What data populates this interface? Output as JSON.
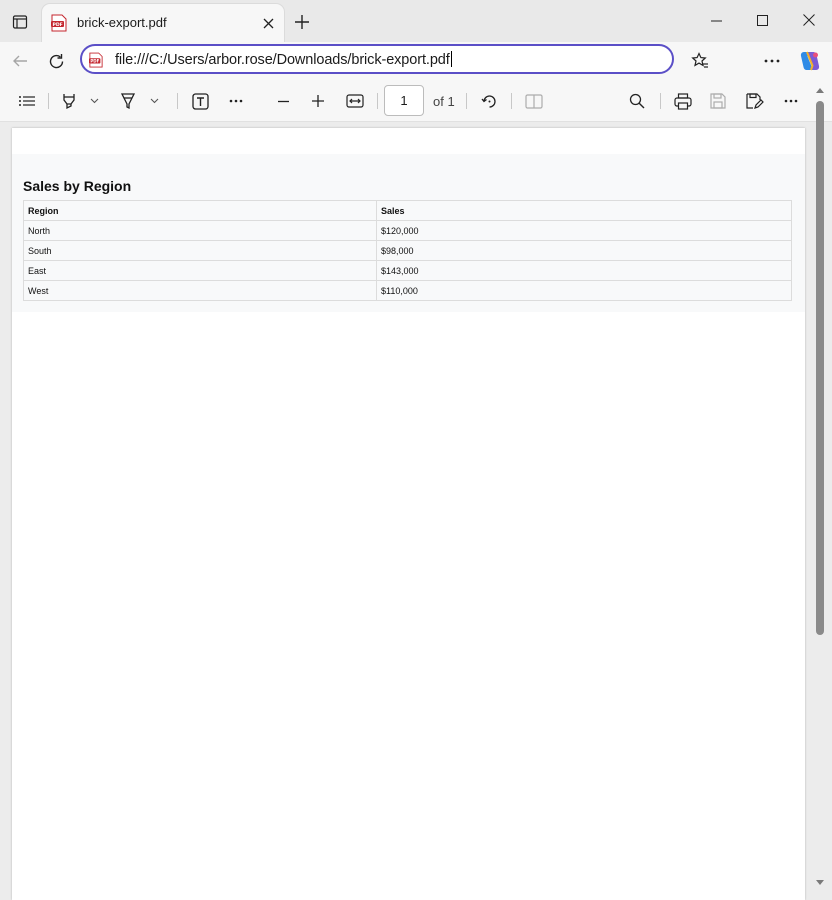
{
  "browser": {
    "tab": {
      "title": "brick-export.pdf"
    },
    "address_bar": {
      "url": "file:///C:/Users/arbor.rose/Downloads/brick-export.pdf"
    }
  },
  "pdf_toolbar": {
    "page_number": "1",
    "page_count_label": "of 1"
  },
  "document": {
    "title": "Sales by Region",
    "table": {
      "headers": [
        "Region",
        "Sales"
      ],
      "rows": [
        [
          "North",
          "$120,000"
        ],
        [
          "South",
          "$98,000"
        ],
        [
          "East",
          "$143,000"
        ],
        [
          "West",
          "$110,000"
        ]
      ]
    }
  },
  "colors": {
    "accent": "#5b4fc7",
    "pdf_icon_red": "#c4262e",
    "chrome_bg": "#f7f7f7",
    "report_bg": "#f8f9fa"
  },
  "icons": {
    "tab_actions": "tab-actions-icon",
    "tab_favicon": "pdf-file-icon",
    "close": "close-icon",
    "new_tab": "plus-icon",
    "back": "back-arrow-icon",
    "refresh": "refresh-icon",
    "favorites": "star-list-icon",
    "more": "ellipsis-icon",
    "copilot": "copilot-icon",
    "contents": "list-icon",
    "highlight": "highlighter-icon",
    "draw": "draw-icon",
    "text": "text-box-icon",
    "zoom_out": "minus-icon",
    "zoom_in": "plus-icon",
    "fit": "fit-width-icon",
    "rotate": "rotate-icon",
    "page_view": "two-page-icon",
    "search": "search-icon",
    "print": "print-icon",
    "save": "save-icon",
    "save_as": "save-as-icon"
  }
}
